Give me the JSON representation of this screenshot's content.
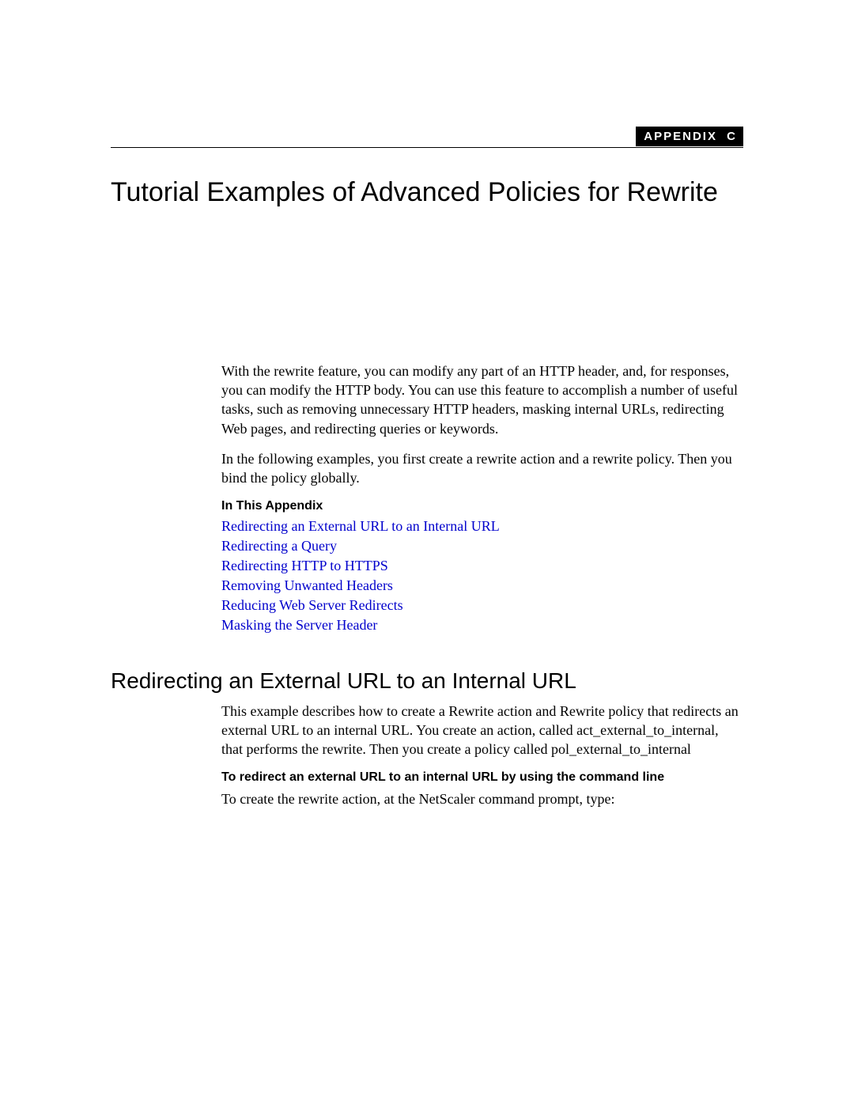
{
  "appendix": {
    "label": "APPENDIX",
    "letter": "C"
  },
  "title": "Tutorial Examples of Advanced Policies for Rewrite",
  "intro": {
    "p1": "With the rewrite feature, you can modify any part of an HTTP header, and, for responses, you can modify the HTTP body. You can use this feature to accomplish a number of useful tasks, such as removing unnecessary HTTP headers, masking internal URLs, redirecting Web pages, and redirecting queries or keywords.",
    "p2": "In the following examples, you first create a rewrite action and a rewrite policy. Then you bind the policy globally."
  },
  "toc": {
    "heading": "In This Appendix",
    "items": [
      "Redirecting an External URL to an Internal URL",
      "Redirecting a Query",
      "Redirecting HTTP to HTTPS",
      "Removing Unwanted Headers",
      "Reducing Web Server Redirects",
      "Masking the Server Header"
    ]
  },
  "section1": {
    "heading": "Redirecting an External URL to an Internal URL",
    "p1": "This example describes how to create a Rewrite action and Rewrite policy that redirects an external URL to an internal URL. You create an action, called act_external_to_internal, that performs the rewrite. Then you create a policy called pol_external_to_internal",
    "procTitle": "To redirect an external URL to an internal URL by using the command line",
    "p2": "To create the rewrite action, at the NetScaler command prompt, type:"
  }
}
